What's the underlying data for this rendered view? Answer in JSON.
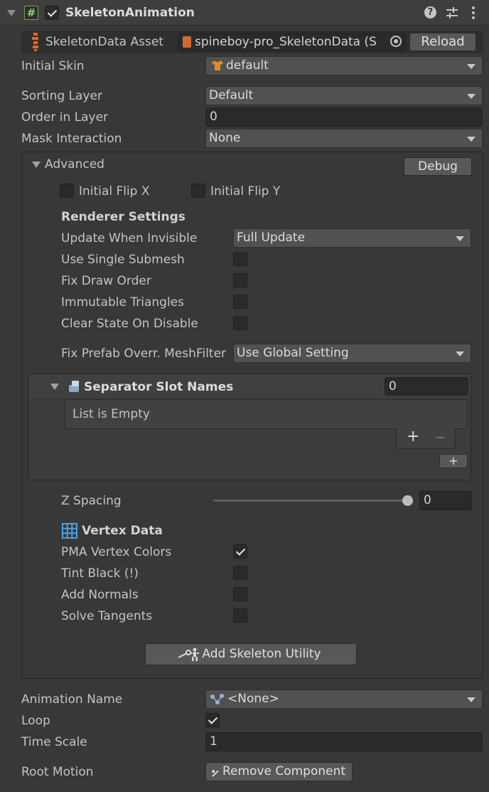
{
  "header": {
    "component_name": "SkeletonAnimation",
    "enabled": true,
    "icons": [
      "expand-triangle-icon",
      "script-hash-icon",
      "help-icon",
      "preset-sliders-icon",
      "kebab-menu-icon"
    ]
  },
  "skeleton_data": {
    "label": "SkeletonData Asset",
    "value": "spineboy-pro_SkeletonData (S",
    "reload_label": "Reload"
  },
  "initial_skin": {
    "label": "Initial Skin",
    "value": "default"
  },
  "sorting_layer": {
    "label": "Sorting Layer",
    "value": "Default"
  },
  "order_in_layer": {
    "label": "Order in Layer",
    "value": "0"
  },
  "mask_interaction": {
    "label": "Mask Interaction",
    "value": "None"
  },
  "advanced": {
    "label": "Advanced",
    "debug_label": "Debug",
    "flip_x_label": "Initial Flip X",
    "flip_x": false,
    "flip_y_label": "Initial Flip Y",
    "flip_y": false
  },
  "renderer_settings": {
    "heading": "Renderer Settings",
    "update_when_invisible": {
      "label": "Update When Invisible",
      "value": "Full Update"
    },
    "use_single_submesh": {
      "label": "Use Single Submesh",
      "checked": false
    },
    "fix_draw_order": {
      "label": "Fix Draw Order",
      "checked": false
    },
    "immutable_triangles": {
      "label": "Immutable Triangles",
      "checked": false
    },
    "clear_state_on_disable": {
      "label": "Clear State On Disable",
      "checked": false
    },
    "fix_prefab": {
      "label": "Fix Prefab Overr. MeshFilter",
      "value": "Use Global Setting"
    }
  },
  "separator_slots": {
    "label": "Separator Slot Names",
    "count": "0",
    "empty_text": "List is Empty",
    "add_symbol": "+",
    "remove_symbol": "−",
    "small_add_symbol": "+"
  },
  "z_spacing": {
    "label": "Z Spacing",
    "value": "0"
  },
  "vertex_data": {
    "heading": "Vertex Data",
    "pma_vertex_colors": {
      "label": "PMA Vertex Colors",
      "checked": true
    },
    "tint_black": {
      "label": "Tint Black (!)",
      "checked": false
    },
    "add_normals": {
      "label": "Add Normals",
      "checked": false
    },
    "solve_tangents": {
      "label": "Solve Tangents",
      "checked": false
    }
  },
  "add_skeleton_utility_label": "Add Skeleton Utility",
  "animation_name": {
    "label": "Animation Name",
    "value": "<None>"
  },
  "loop": {
    "label": "Loop",
    "checked": true
  },
  "time_scale": {
    "label": "Time Scale",
    "value": "1"
  },
  "root_motion": {
    "label": "Root Motion",
    "button_label": "Remove Component"
  },
  "colors": {
    "background": "#383838",
    "field": "#2a2a2a",
    "button": "#585858",
    "accent_icon": "#e06a2b",
    "grid_icon": "#4aa3df"
  }
}
